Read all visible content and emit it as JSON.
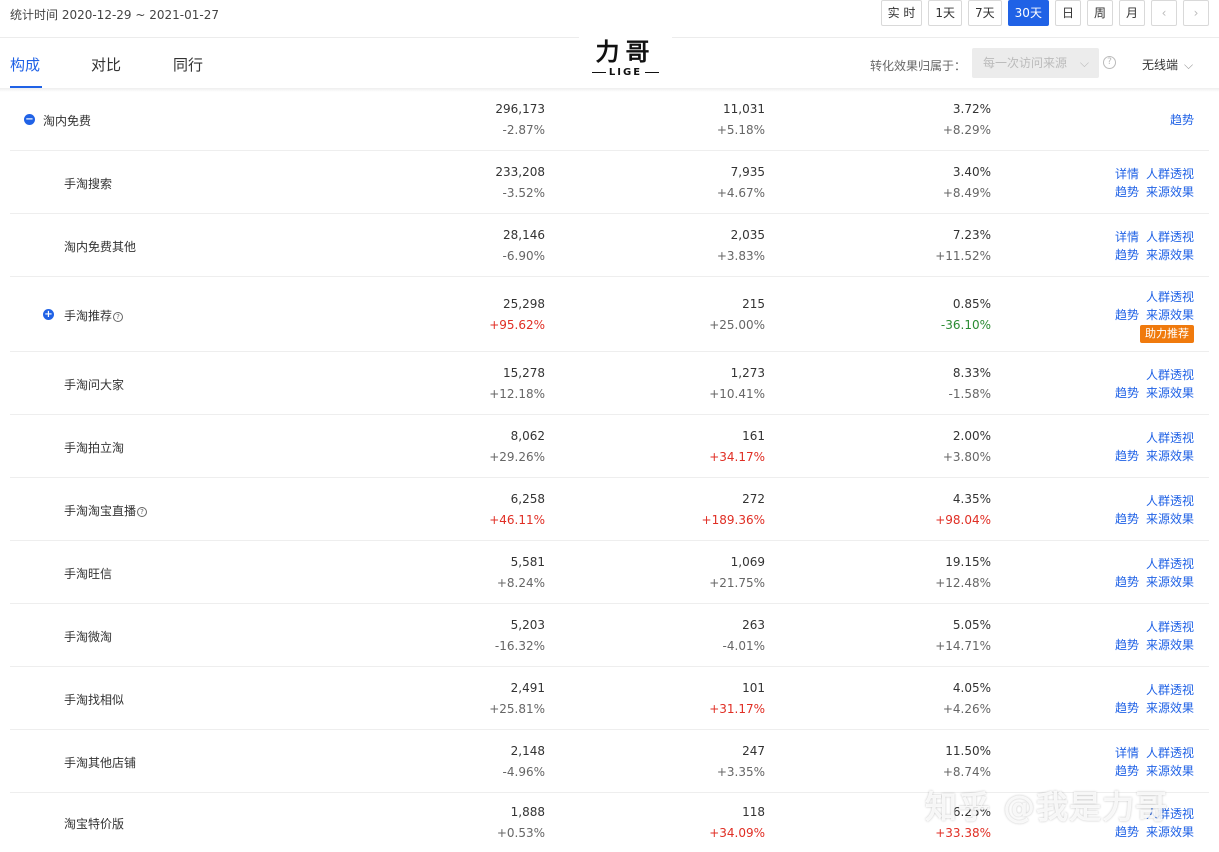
{
  "header": {
    "stat_time": "统计时间 2020-12-29 ~ 2021-01-27",
    "periods": [
      "实 时",
      "1天",
      "7天",
      "30天",
      "日",
      "周",
      "月"
    ],
    "active_period": "30天",
    "prev_icon": "chevron-left-icon",
    "next_icon": "chevron-right-icon"
  },
  "tabs": [
    "构成",
    "对比",
    "同行"
  ],
  "active_tab": "构成",
  "logo": {
    "cn": "力哥",
    "en": "LIGE"
  },
  "attribution": {
    "label": "转化效果归属于：",
    "select_value": "每一次访问来源",
    "device_value": "无线端"
  },
  "colors": {
    "accent": "#2062e6",
    "badge": "#f07a0d",
    "up": "#e02e24",
    "down": "#2a8b32"
  },
  "rows": [
    {
      "name": "淘内免费",
      "v1": "296,173",
      "c1": "-2.87%",
      "v2": "11,031",
      "c2": "+5.18%",
      "v3": "3.72%",
      "c3": "+8.29%",
      "actions": [
        "趋势"
      ]
    },
    {
      "name": "手淘搜索",
      "v1": "233,208",
      "c1": "-3.52%",
      "v2": "7,935",
      "c2": "+4.67%",
      "v3": "3.40%",
      "c3": "+8.49%",
      "actions": [
        "详情",
        "人群透视",
        "趋势",
        "来源效果"
      ]
    },
    {
      "name": "淘内免费其他",
      "v1": "28,146",
      "c1": "-6.90%",
      "v2": "2,035",
      "c2": "+3.83%",
      "v3": "7.23%",
      "c3": "+11.52%",
      "actions": [
        "详情",
        "人群透视",
        "趋势",
        "来源效果"
      ]
    },
    {
      "name": "手淘推荐",
      "v1": "25,298",
      "c1": "+95.62%",
      "v2": "215",
      "c2": "+25.00%",
      "v3": "0.85%",
      "c3": "-36.10%",
      "actions": [
        "人群透视",
        "趋势",
        "来源效果"
      ],
      "badge": "助力推荐"
    },
    {
      "name": "手淘问大家",
      "v1": "15,278",
      "c1": "+12.18%",
      "v2": "1,273",
      "c2": "+10.41%",
      "v3": "8.33%",
      "c3": "-1.58%",
      "actions": [
        "人群透视",
        "趋势",
        "来源效果"
      ]
    },
    {
      "name": "手淘拍立淘",
      "v1": "8,062",
      "c1": "+29.26%",
      "v2": "161",
      "c2": "+34.17%",
      "v3": "2.00%",
      "c3": "+3.80%",
      "actions": [
        "人群透视",
        "趋势",
        "来源效果"
      ]
    },
    {
      "name": "手淘淘宝直播",
      "v1": "6,258",
      "c1": "+46.11%",
      "v2": "272",
      "c2": "+189.36%",
      "v3": "4.35%",
      "c3": "+98.04%",
      "actions": [
        "人群透视",
        "趋势",
        "来源效果"
      ]
    },
    {
      "name": "手淘旺信",
      "v1": "5,581",
      "c1": "+8.24%",
      "v2": "1,069",
      "c2": "+21.75%",
      "v3": "19.15%",
      "c3": "+12.48%",
      "actions": [
        "人群透视",
        "趋势",
        "来源效果"
      ]
    },
    {
      "name": "手淘微淘",
      "v1": "5,203",
      "c1": "-16.32%",
      "v2": "263",
      "c2": "-4.01%",
      "v3": "5.05%",
      "c3": "+14.71%",
      "actions": [
        "人群透视",
        "趋势",
        "来源效果"
      ]
    },
    {
      "name": "手淘找相似",
      "v1": "2,491",
      "c1": "+25.81%",
      "v2": "101",
      "c2": "+31.17%",
      "v3": "4.05%",
      "c3": "+4.26%",
      "actions": [
        "人群透视",
        "趋势",
        "来源效果"
      ]
    },
    {
      "name": "手淘其他店铺",
      "v1": "2,148",
      "c1": "-4.96%",
      "v2": "247",
      "c2": "+3.35%",
      "v3": "11.50%",
      "c3": "+8.74%",
      "actions": [
        "详情",
        "人群透视",
        "趋势",
        "来源效果"
      ]
    },
    {
      "name": "淘宝特价版",
      "v1": "1,888",
      "c1": "+0.53%",
      "v2": "118",
      "c2": "+34.09%",
      "v3": "6.25%",
      "c3": "+33.38%",
      "actions": [
        "人群透视",
        "趋势",
        "来源效果"
      ]
    }
  ],
  "watermark": "知乎 @我是力哥"
}
